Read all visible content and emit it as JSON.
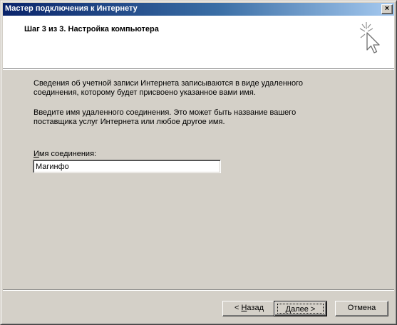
{
  "window": {
    "title": "Мастер подключения к Интернету",
    "close_glyph": "×"
  },
  "header": {
    "step_title": "Шаг 3 из 3. Настройка компьютера",
    "icon": "wizard-cursor-sparkle-icon"
  },
  "body": {
    "paragraph1_line1": "Сведения об учетной записи Интернета записываются в виде удаленного",
    "paragraph1_line2": "соединения, которому будет присвоено указанное вами имя.",
    "paragraph2_line1": "Введите имя удаленного соединения. Это может быть название вашего",
    "paragraph2_line2": "поставщика услуг Интернета или любое другое имя.",
    "field_label_accel": "И",
    "field_label_rest": "мя соединения:",
    "connection_name_value": "Магинфо"
  },
  "buttons": {
    "back_accel": "Н",
    "back_prefix": "< ",
    "back_rest": "азад",
    "next_label": "Далее >",
    "cancel_label": "Отмена"
  }
}
